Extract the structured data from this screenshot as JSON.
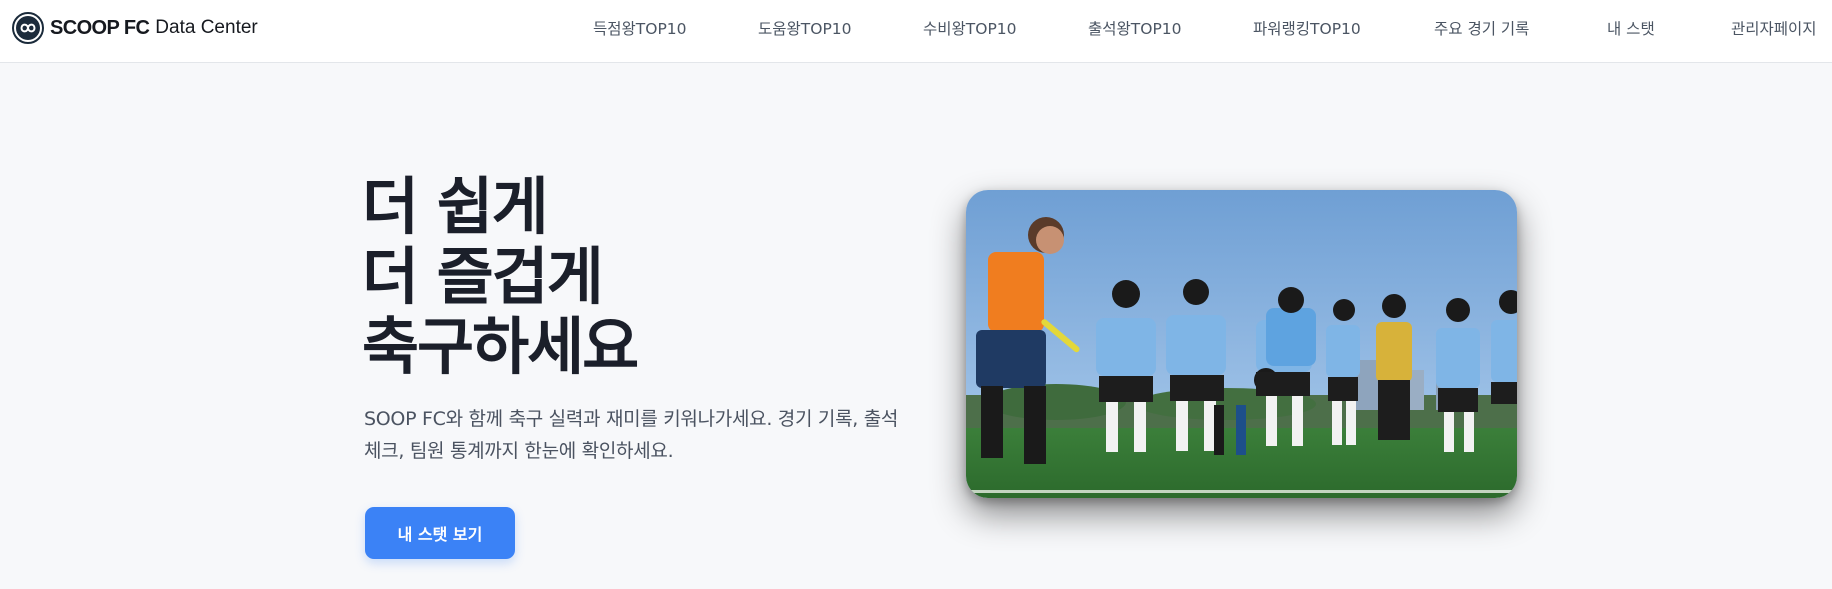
{
  "brand": {
    "name": "SCOOP FC",
    "subtitle": "Data Center",
    "logo_icon": "infinity-badge-icon"
  },
  "nav": {
    "items": [
      {
        "label": "득점왕TOP10"
      },
      {
        "label": "도움왕TOP10"
      },
      {
        "label": "수비왕TOP10"
      },
      {
        "label": "출석왕TOP10"
      },
      {
        "label": "파워랭킹TOP10"
      },
      {
        "label": "주요 경기 기록"
      },
      {
        "label": "내 스탯"
      },
      {
        "label": "관리자페이지"
      }
    ]
  },
  "hero": {
    "title_lines": [
      "더 쉽게",
      "더 즐겁게",
      "축구하세요"
    ],
    "description": "SOOP FC와 함께 축구 실력과 재미를 키워나가세요. 경기 기록, 출석 체크, 팀원 통계까지 한눈에 확인하세요.",
    "cta_label": "내 스탯 보기"
  },
  "photo": {
    "subject": "team-photo"
  },
  "colors": {
    "accent": "#3b82f6",
    "background": "#f7f8fa",
    "header": "#ffffff",
    "text": "#1b1f2a"
  }
}
